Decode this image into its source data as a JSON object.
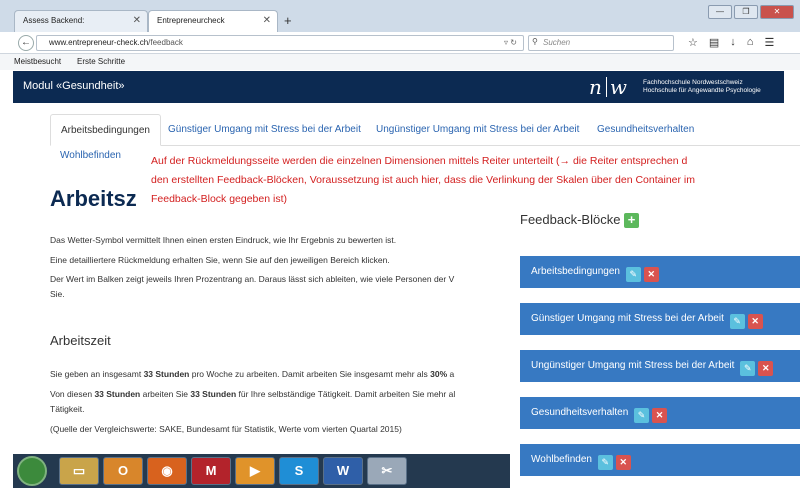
{
  "browser": {
    "tabs": [
      {
        "label": "Assess Backend:"
      },
      {
        "label": "Entrepreneurcheck"
      }
    ],
    "url_host": "www.entrepreneur-check.ch",
    "url_path": "/feedback",
    "search_placeholder": "Suchen",
    "bookmarks": [
      "Meistbesucht",
      "Erste Schritte"
    ]
  },
  "header": {
    "module_title": "Modul «Gesundheit»",
    "logo_text": "n|w",
    "school_line1": "Fachhochschule Nordwestschweiz",
    "school_line2": "Hochschule für Angewandte Psychologie"
  },
  "page_tabs": [
    {
      "label": "Arbeitsbedingungen",
      "active": true
    },
    {
      "label": "Günstiger Umgang mit Stress bei der Arbeit"
    },
    {
      "label": "Ungünstiger Umgang mit Stress bei der Arbeit"
    },
    {
      "label": "Gesundheitsverhalten"
    },
    {
      "label": "Wohlbefinden"
    }
  ],
  "annotation_lines": [
    "Auf der Rückmeldungsseite werden die einzelnen Dimensionen mittels Reiter unterteilt (→ die Reiter entsprechen d",
    "den erstellten  Feedback-Blöcken, Voraussetzung ist auch hier, dass die Verlinkung der Skalen über den Container im",
    "Feedback-Block gegeben ist)"
  ],
  "content": {
    "heading": "Arbeitsz",
    "paragraphs": [
      "Das Wetter-Symbol vermittelt Ihnen einen ersten Eindruck, wie Ihr Ergebnis zu bewerten ist.",
      "Eine detailliertere Rückmeldung erhalten Sie, wenn Sie auf den jeweiligen Bereich klicken.",
      "Der Wert im Balken zeigt jeweils Ihren Prozentrang an. Daraus lässt sich ableiten, wie viele Personen der V",
      "Sie."
    ],
    "subheading": "Arbeitszeit",
    "details": [
      "Sie geben an insgesamt 33 Stunden pro Woche zu arbeiten. Damit arbeiten Sie insgesamt mehr als 30% a",
      "Von diesen 33 Stunden arbeiten Sie 33 Stunden für Ihre selbständige Tätigkeit. Damit arbeiten Sie mehr al",
      "Tätigkeit.",
      "(Quelle der Vergleichswerte: SAKE, Bundesamt für Statistik, Werte vom vierten Quartal 2015)"
    ]
  },
  "feedback_panel": {
    "title": "Feedback-Blöcke",
    "add_label": "+",
    "blocks": [
      {
        "label": "Arbeitsbedingungen"
      },
      {
        "label": "Günstiger Umgang mit Stress bei der Arbeit"
      },
      {
        "label": "Ungünstiger Umgang mit Stress bei der Arbeit"
      },
      {
        "label": "Gesundheitsverhalten"
      },
      {
        "label": "Wohlbefinden"
      }
    ],
    "edit_icon": "pencil-icon",
    "delete_icon": "close-icon"
  },
  "colors": {
    "header_bg": "#0c2a52",
    "tab_link": "#2a64b0",
    "annotation": "#d32020",
    "block_bg": "#3779c2",
    "edit_btn": "#5bc0de",
    "delete_btn": "#d9534f",
    "add_btn": "#5cb85c"
  },
  "taskbar_icons": [
    "windows-start-icon",
    "explorer-icon",
    "outlook-icon",
    "firefox-icon",
    "app-m-icon",
    "media-player-icon",
    "skype-icon",
    "word-icon",
    "snipping-tool-icon"
  ]
}
